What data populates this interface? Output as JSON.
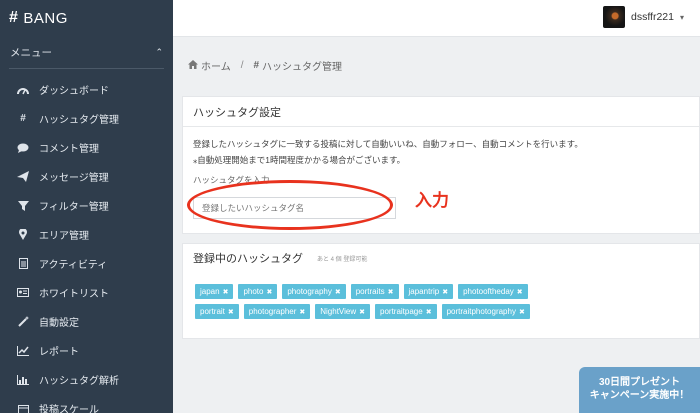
{
  "brand": {
    "logo_glyph": "#",
    "name": "BANG"
  },
  "sidebar": {
    "menu_label": "メニュー",
    "items": [
      {
        "label": "ダッシュボード",
        "icon": "dashboard-icon"
      },
      {
        "label": "ハッシュタグ管理",
        "icon": "hashtag-icon"
      },
      {
        "label": "コメント管理",
        "icon": "comment-icon"
      },
      {
        "label": "メッセージ管理",
        "icon": "send-icon"
      },
      {
        "label": "フィルター管理",
        "icon": "filter-icon"
      },
      {
        "label": "エリア管理",
        "icon": "map-marker-icon"
      },
      {
        "label": "アクティビティ",
        "icon": "document-icon"
      },
      {
        "label": "ホワイトリスト",
        "icon": "id-card-icon"
      },
      {
        "label": "自動設定",
        "icon": "magic-wand-icon"
      },
      {
        "label": "レポート",
        "icon": "line-chart-icon"
      },
      {
        "label": "ハッシュタグ解析",
        "icon": "bar-chart-icon"
      },
      {
        "label": "投稿スケール",
        "icon": "calendar-icon"
      }
    ]
  },
  "user": {
    "name": "dssffr221"
  },
  "breadcrumb": {
    "home": "ホーム",
    "current": "ハッシュタグ管理"
  },
  "settings_panel": {
    "title": "ハッシュタグ設定",
    "description": "登録したハッシュタグに一致する投稿に対して自動いいね、自動フォロー、自動コメントを行います。",
    "note": "⁎自動処理開始まで1時間程度かかる場合がございます。",
    "field_label": "ハッシュタグを入力",
    "input_placeholder": "登録したいハッシュタグ名"
  },
  "annotation": {
    "text": "入力"
  },
  "registered_panel": {
    "title": "登録中のハッシュタグ",
    "remaining": "あと 4 個 登録可能",
    "tags": [
      "japan",
      "photo",
      "photography",
      "portraits",
      "japantrip",
      "photooftheday",
      "portrait",
      "photographer",
      "NightView",
      "portraitpage",
      "portraitphotography"
    ]
  },
  "campaign": {
    "line1": "30日間プレゼント",
    "line2": "キャンペーン実施中！"
  },
  "colors": {
    "sidebar_bg": "#2f3d4c",
    "tag_bg": "#5bbfdb",
    "annotation": "#e8321e",
    "campaign_bg": "#6aa1c9"
  }
}
